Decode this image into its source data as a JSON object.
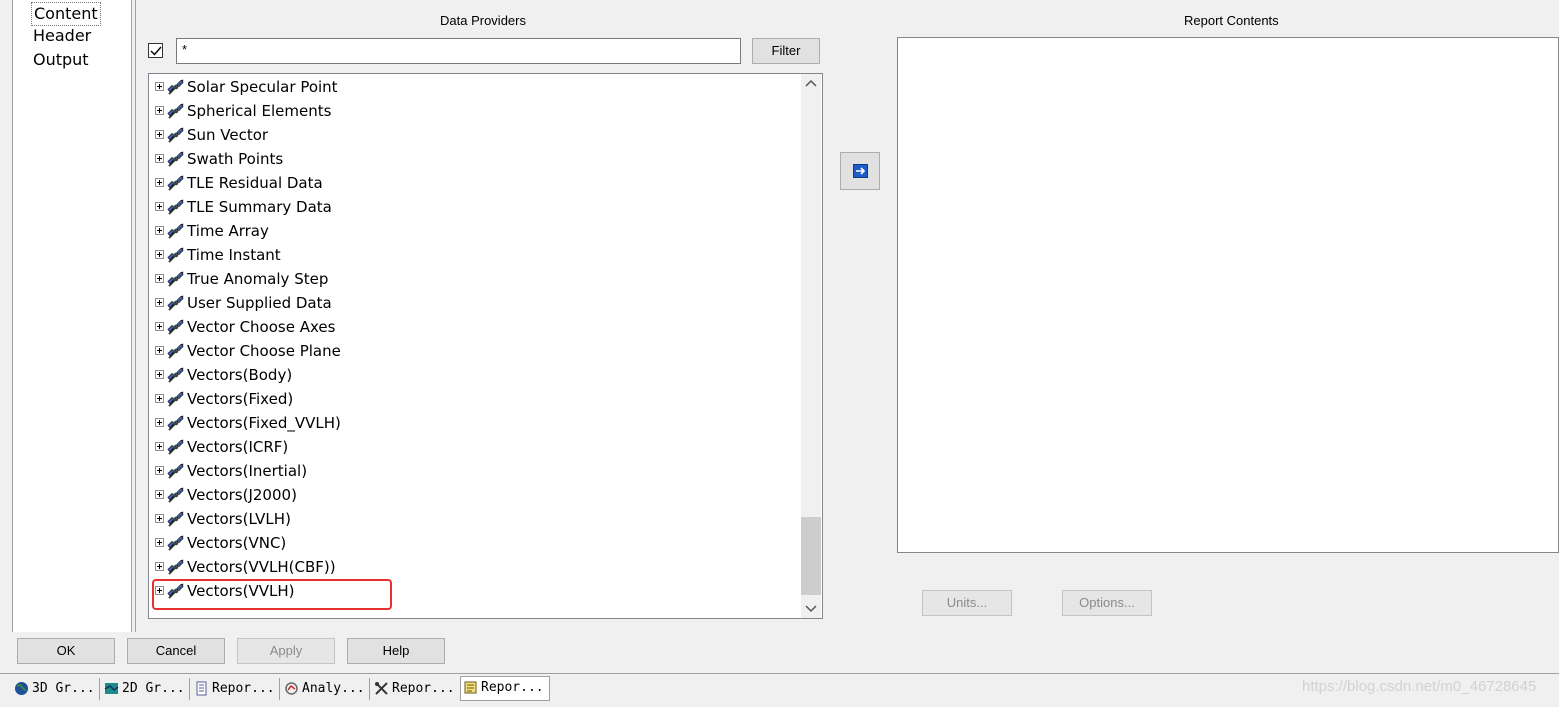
{
  "nav": {
    "items": [
      "Content",
      "Header",
      "Output"
    ]
  },
  "data_providers": {
    "heading": "Data Providers",
    "filter_value": "*",
    "filter_button": "Filter",
    "items": [
      "Solar Specular Point",
      "Spherical Elements",
      "Sun Vector",
      "Swath Points",
      "TLE Residual Data",
      "TLE Summary Data",
      "Time Array",
      "Time Instant",
      "True Anomaly Step",
      "User Supplied Data",
      "Vector Choose Axes",
      "Vector Choose Plane",
      "Vectors(Body)",
      "Vectors(Fixed)",
      "Vectors(Fixed_VVLH)",
      "Vectors(ICRF)",
      "Vectors(Inertial)",
      "Vectors(J2000)",
      "Vectors(LVLH)",
      "Vectors(VNC)",
      "Vectors(VVLH(CBF))",
      "Vectors(VVLH)"
    ],
    "item_icon": "satellite-icon",
    "highlighted_item": "Vectors(VVLH)",
    "highlight_color": "#e8312f"
  },
  "report_contents": {
    "heading": "Report Contents",
    "units_button": "Units...",
    "options_button": "Options..."
  },
  "footer": {
    "ok": "OK",
    "cancel": "Cancel",
    "apply": "Apply",
    "help": "Help"
  },
  "taskbar": {
    "tabs": [
      {
        "label": "3D Gr...",
        "icon": "globe-icon"
      },
      {
        "label": "2D Gr...",
        "icon": "map-icon"
      },
      {
        "label": "Repor...",
        "icon": "report-icon"
      },
      {
        "label": "Analy...",
        "icon": "analysis-icon"
      },
      {
        "label": "Repor...",
        "icon": "tools-icon"
      },
      {
        "label": "Repor...",
        "icon": "report-notepad-icon"
      }
    ]
  },
  "watermark": "https://blog.csdn.net/m0_46728645"
}
